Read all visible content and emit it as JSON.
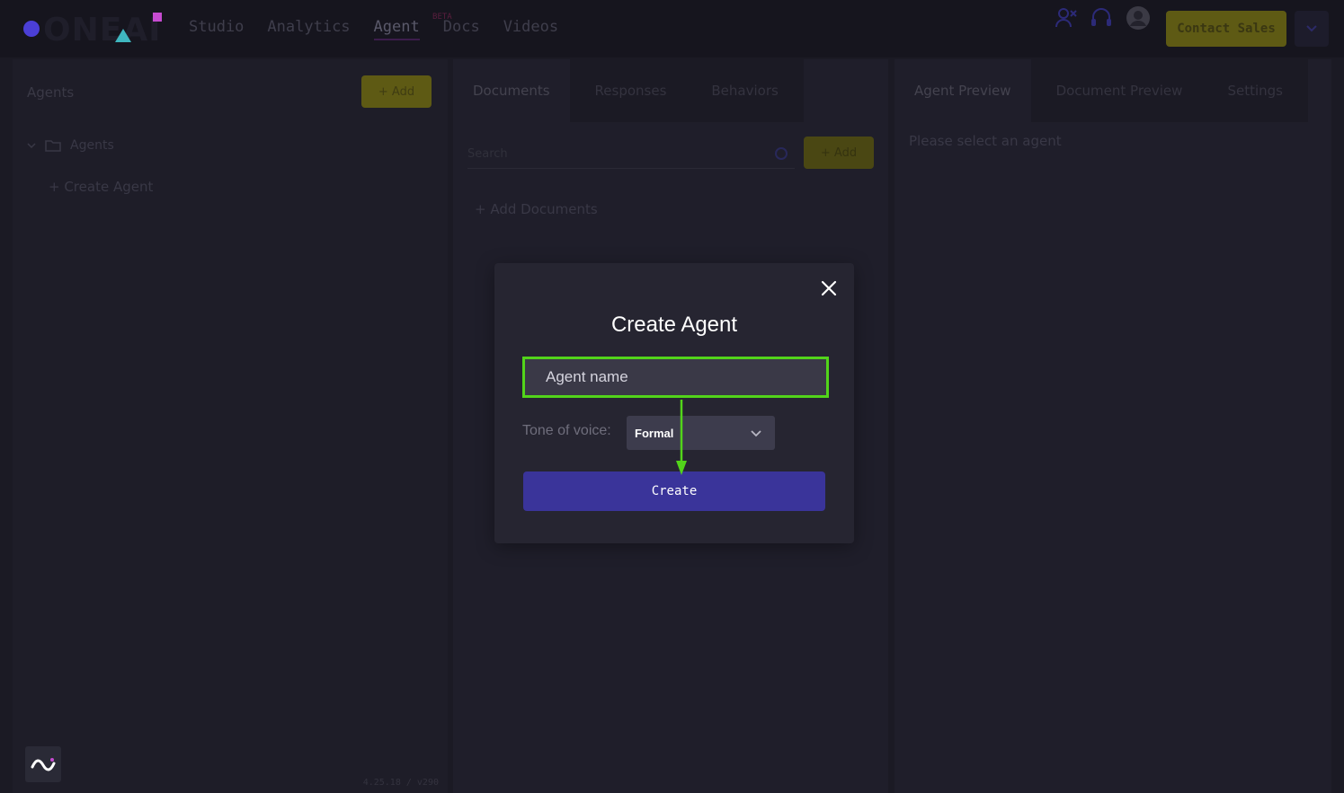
{
  "nav": {
    "logo_text": "ONEAI",
    "links": [
      {
        "label": "Studio"
      },
      {
        "label": "Analytics"
      },
      {
        "label": "Agent",
        "badge": "BETA"
      },
      {
        "label": "Docs"
      },
      {
        "label": "Videos"
      }
    ],
    "contact_label": "Contact Sales"
  },
  "left_panel": {
    "title": "Agents",
    "add_label": "+ Add",
    "tree_folder": "Agents",
    "tree_create": "+ Create Agent",
    "version": "4.25.18 / v290"
  },
  "middle_panel": {
    "tabs": [
      "Documents",
      "Responses",
      "Behaviors"
    ],
    "search_placeholder": "Search",
    "add_label": "+ Add",
    "add_documents": "+ Add Documents"
  },
  "right_panel": {
    "tabs": [
      "Agent Preview",
      "Document Preview",
      "Settings"
    ],
    "empty_message": "Please select an agent"
  },
  "modal": {
    "title": "Create Agent",
    "name_placeholder": "Agent name",
    "tone_label": "Tone of voice:",
    "tone_value": "Formal",
    "create_label": "Create"
  },
  "colors": {
    "accent_purple": "#3a349a",
    "highlight_green": "#52d41a",
    "brand_yellow": "#5e5a14"
  }
}
